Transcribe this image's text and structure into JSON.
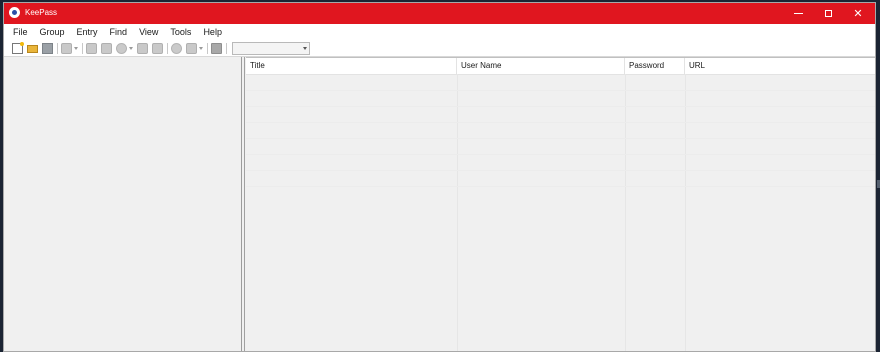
{
  "window": {
    "title": "KeePass",
    "accent_color": "#e0161f",
    "controls": {
      "minimize": "minimize-icon",
      "maximize": "maximize-icon",
      "close": "close-icon"
    }
  },
  "menu": {
    "items": [
      "File",
      "Group",
      "Entry",
      "Find",
      "View",
      "Tools",
      "Help"
    ]
  },
  "toolbar": {
    "buttons": [
      "new-database-icon",
      "open-database-icon",
      "save-icon",
      "add-entry-icon",
      "copy-username-icon",
      "copy-password-icon",
      "open-url-icon",
      "autotype-icon",
      "print-icon",
      "find-icon",
      "sort-icon",
      "lock-icon"
    ],
    "quick_find_value": ""
  },
  "entry_list": {
    "columns": [
      "Title",
      "User Name",
      "Password",
      "URL"
    ],
    "rows": []
  }
}
